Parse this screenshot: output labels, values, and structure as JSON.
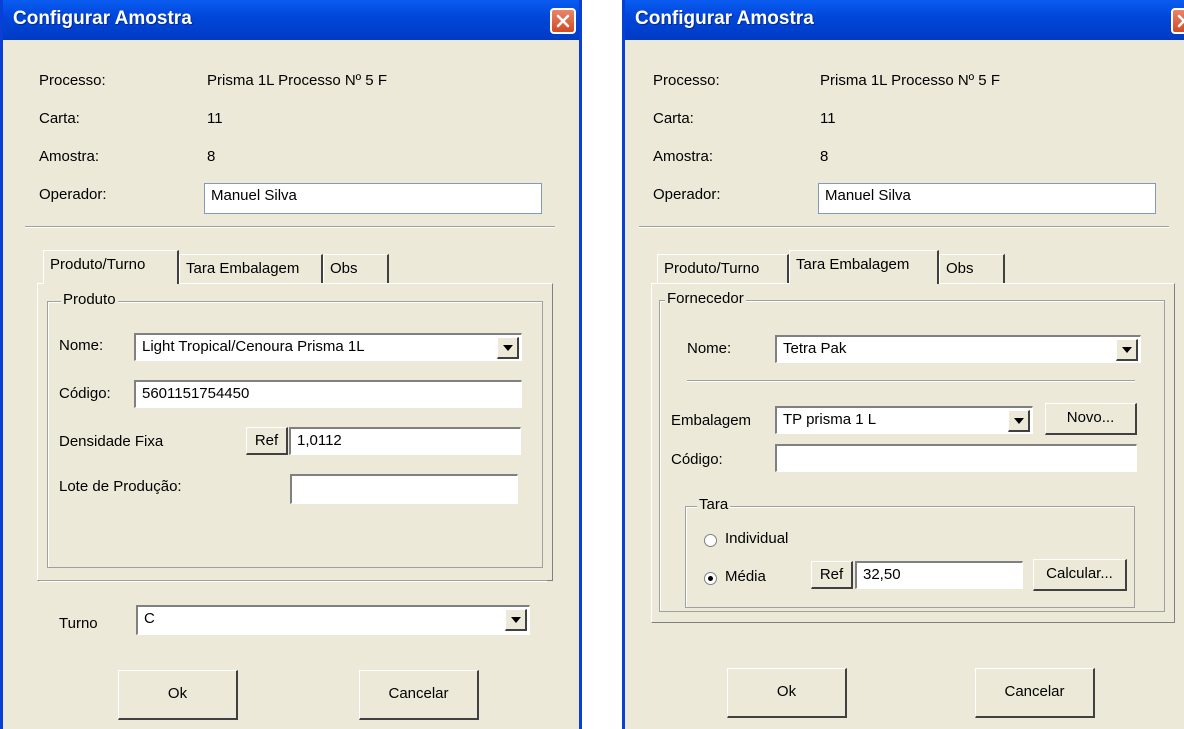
{
  "dialogs": [
    {
      "title": "Configurar Amostra",
      "processo_label": "Processo:",
      "processo_value": "Prisma 1L Processo Nº 5 F",
      "carta_label": "Carta:",
      "carta_value": "11",
      "amostra_label": "Amostra:",
      "amostra_value": "8",
      "operador_label": "Operador:",
      "operador_value": "Manuel Silva",
      "tabs": [
        "Produto/Turno",
        "Tara Embalagem",
        "Obs"
      ],
      "active_tab": "Produto/Turno",
      "produto": {
        "legend": "Produto",
        "nome_label": "Nome:",
        "nome_value": "Light Tropical/Cenoura Prisma 1L",
        "codigo_label": "Código:",
        "codigo_value": "5601151754450",
        "densidade_label": "Densidade Fixa",
        "ref_label": "Ref",
        "densidade_value": "1,0112",
        "lote_label": "Lote de Produção:",
        "lote_value": ""
      },
      "turno_label": "Turno",
      "turno_value": "C",
      "ok_label": "Ok",
      "cancel_label": "Cancelar"
    },
    {
      "title": "Configurar Amostra",
      "processo_label": "Processo:",
      "processo_value": "Prisma 1L Processo Nº 5 F",
      "carta_label": "Carta:",
      "carta_value": "11",
      "amostra_label": "Amostra:",
      "amostra_value": "8",
      "operador_label": "Operador:",
      "operador_value": "Manuel Silva",
      "tabs": [
        "Produto/Turno",
        "Tara Embalagem",
        "Obs"
      ],
      "active_tab": "Tara Embalagem",
      "fornecedor": {
        "legend": "Fornecedor",
        "nome_label": "Nome:",
        "nome_value": "Tetra Pak",
        "embalagem_label": "Embalagem",
        "embalagem_value": "TP prisma 1 L",
        "novo_label": "Novo...",
        "codigo_label": "Código:",
        "codigo_value": ""
      },
      "tara": {
        "legend": "Tara",
        "individual_label": "Individual",
        "media_label": "Média",
        "selected": "Média",
        "ref_label": "Ref",
        "media_value": "32,50",
        "calcular_label": "Calcular..."
      },
      "ok_label": "Ok",
      "cancel_label": "Cancelar"
    }
  ],
  "colors": {
    "titlebar": "#0047dc",
    "dialog_bg": "#ece9d8",
    "close_button": "#d24a22"
  },
  "icons": [
    "close-icon",
    "chevron-down-icon"
  ]
}
